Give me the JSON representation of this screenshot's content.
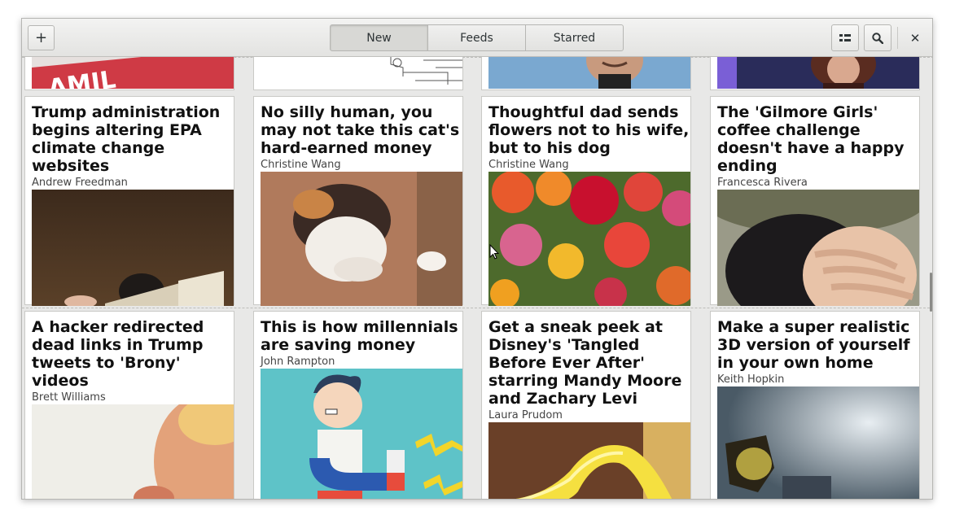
{
  "header": {
    "add_label": "+",
    "tabs": [
      {
        "label": "New",
        "active": true
      },
      {
        "label": "Feeds",
        "active": false
      },
      {
        "label": "Starred",
        "active": false
      }
    ],
    "close_label": "✕"
  },
  "articles": [
    {
      "title": "Trump administration begins altering EPA climate change websites",
      "author": "Andrew Freedman"
    },
    {
      "title": "No silly human, you may not take this cat's hard-earned money",
      "author": "Christine Wang"
    },
    {
      "title": "Thoughtful dad sends flowers not to his wife, but to his dog",
      "author": "Christine Wang"
    },
    {
      "title": "The 'Gilmore Girls' coffee challenge doesn't have a happy ending",
      "author": "Francesca Rivera"
    },
    {
      "title": "A hacker redirected dead links in Trump tweets to 'Brony' videos",
      "author": "Brett Williams"
    },
    {
      "title": "This is how millennials are saving money",
      "author": "John Rampton"
    },
    {
      "title": "Get a sneak peek at Disney's 'Tangled Before Ever After' starring Mandy Moore and Zachary Levi",
      "author": "Laura Prudom"
    },
    {
      "title": "Make a super realistic 3D version of yourself in your own home",
      "author": "Keith Hopkin"
    }
  ],
  "top_partial_text": "AMIL"
}
